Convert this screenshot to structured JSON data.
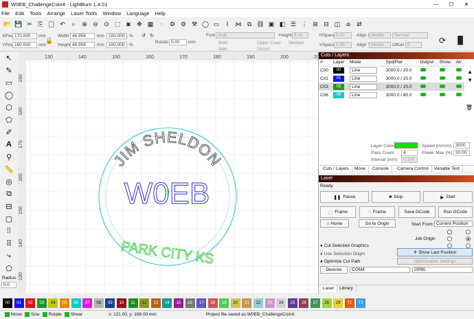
{
  "window": {
    "title": "W0EB_ChallengeCoin4 - LightBurn 1.4.01",
    "controls": [
      "—",
      "☐",
      "✕"
    ]
  },
  "menu": [
    "File",
    "Edit",
    "Tools",
    "Arrange",
    "Laser Tools",
    "Window",
    "Language",
    "Help"
  ],
  "toolbar_icons": [
    "open-icon",
    "save-icon",
    "cut-icon",
    "copy-icon",
    "paste-icon",
    "undo-icon",
    "search-icon",
    "zoom-in-icon",
    "zoom-out-icon",
    "zoom-fit-icon",
    "frame-icon",
    "camera-icon",
    "move-icon",
    "grid-icon",
    "bulb-icon",
    "gear-icon",
    "settings-icon",
    "tools-icon",
    "circle-icon",
    "rect-icon",
    "path-icon",
    "node-icon",
    "bool-icon",
    "chain-icon",
    "group-icon",
    "mirror-icon",
    "align-icon",
    "dist-icon",
    "ungroup-icon",
    "weld-icon",
    "offset-icon",
    "array-icon",
    "flip-icon"
  ],
  "props": {
    "xpos_label": "XPos",
    "xpos": "170.000",
    "ypos_label": "YPos",
    "ypos": "160.000",
    "mm": "mm",
    "width_label": "Width",
    "width": "46.958",
    "height_label": "Height",
    "height": "46.958",
    "pct_w": "100.000",
    "pct_h": "100.000",
    "pct": "%",
    "rotate_label": "Rotate",
    "rotate": "0.00",
    "font_label": "Font",
    "font": "Arial",
    "fheight_label": "Height",
    "fheight": "5.00",
    "bold": "Bold",
    "italic": "Italic",
    "upper": "Upper Case",
    "distort": "Distort",
    "welded": "Welded",
    "hspace_label": "HSpace",
    "hspace": "0.00",
    "vspace_label": "VSpace",
    "vspace": "0.00",
    "alignx_label": "Align X",
    "alignx": "Middle",
    "aligny_label": "Align Y",
    "aligny": "Middle",
    "normal": "Normal",
    "offset_label": "Offset",
    "offset": "0"
  },
  "ruler_top": [
    "130",
    "140",
    "150",
    "160",
    "170",
    "180",
    "190",
    "200",
    "210"
  ],
  "ruler_left": [
    "190",
    "180",
    "170",
    "160",
    "150",
    "140",
    "130"
  ],
  "canvas": {
    "arc_text": "JIM SHELDON",
    "center_text": "W0EB",
    "bottom_text": "PARK CITY KS"
  },
  "cuts_panel": {
    "title": "Cuts / Layers",
    "headers": [
      "#",
      "Layer",
      "Mode",
      "Spd/Pwr",
      "Output",
      "Show",
      "Air"
    ],
    "rows": [
      {
        "id": "C00",
        "layer": "00",
        "color": "#000000",
        "mode": "Line",
        "spdpwr": "3000.0 / 20.0"
      },
      {
        "id": "C01",
        "layer": "01",
        "color": "#1414e6",
        "mode": "Line",
        "spdpwr": "3000.0 / 20.0"
      },
      {
        "id": "C03",
        "layer": "03",
        "color": "#1e9628",
        "mode": "Line",
        "spdpwr": "3000.0 / 20.0"
      },
      {
        "id": "C06",
        "layer": "06",
        "color": "#14c8c8",
        "mode": "Line",
        "spdpwr": "3000.0 / 80.0"
      }
    ],
    "layer_color_label": "Layer Color",
    "speed_label": "Speed (mm/m)",
    "speed": "3000",
    "pass_label": "Pass Count",
    "pass": "4",
    "power_label": "Power Max (%)",
    "power": "20.00",
    "interval_label": "Interval (mm)",
    "interval": "0.100",
    "tabs": [
      "Cuts / Layers",
      "Move",
      "Console",
      "Camera Control",
      "Variable Text"
    ]
  },
  "laser_panel": {
    "title": "Laser",
    "status": "Ready",
    "pause": "Pause",
    "stop": "Stop",
    "start": "Start",
    "frame1": "Frame",
    "frame2": "Frame",
    "save_gcode": "Save GCode",
    "run_gcode": "Run GCode",
    "home": "Home",
    "go_origin": "Go to Origin",
    "start_from_label": "Start From:",
    "start_from": "Current Position",
    "job_origin_label": "Job Origin",
    "cut_selected": "Cut Selected Graphics",
    "use_selection": "Use Selection Origin",
    "optimize": "Optimize Cut Path",
    "show_last": "Show Last Position",
    "opt_settings": "Optimization Settings",
    "devices": "Devices",
    "port": "COM4",
    "firmware": "GRBL",
    "tabs": [
      "Laser",
      "Library"
    ]
  },
  "palette": [
    {
      "l": "00",
      "c": "#000000"
    },
    {
      "l": "01",
      "c": "#1414e6"
    },
    {
      "l": "02",
      "c": "#dc1414"
    },
    {
      "l": "03",
      "c": "#1e9628"
    },
    {
      "l": "04",
      "c": "#c8c800"
    },
    {
      "l": "05",
      "c": "#e68c00"
    },
    {
      "l": "06",
      "c": "#14c8c8"
    },
    {
      "l": "07",
      "c": "#e614e6"
    },
    {
      "l": "08",
      "c": "#b4b4b4"
    },
    {
      "l": "09",
      "c": "#1e3c96"
    },
    {
      "l": "10",
      "c": "#961414"
    },
    {
      "l": "11",
      "c": "#14961e"
    },
    {
      "l": "12",
      "c": "#96961e"
    },
    {
      "l": "13",
      "c": "#b46414"
    },
    {
      "l": "14",
      "c": "#1e9696"
    },
    {
      "l": "15",
      "c": "#961e96"
    },
    {
      "l": "16",
      "c": "#787878"
    },
    {
      "l": "17",
      "c": "#5a5ac8"
    },
    {
      "l": "18",
      "c": "#c85a5a"
    },
    {
      "l": "19",
      "c": "#5ac85a"
    },
    {
      "l": "20",
      "c": "#c8c85a"
    },
    {
      "l": "21",
      "c": "#c8965a"
    },
    {
      "l": "22",
      "c": "#96d2d2"
    },
    {
      "l": "23",
      "c": "#d296d2"
    },
    {
      "l": "24",
      "c": "#d2d2d2"
    },
    {
      "l": "25",
      "c": "#5a3c96"
    },
    {
      "l": "26",
      "c": "#963c5a"
    },
    {
      "l": "27",
      "c": "#3c965a"
    },
    {
      "l": "28",
      "c": "#aad23c"
    },
    {
      "l": "29",
      "c": "#e6d23c"
    },
    {
      "l": "T1",
      "c": "#e65a14"
    },
    {
      "l": "T2",
      "c": "#3ca0e6"
    }
  ],
  "status": {
    "move": "Move",
    "size": "Size",
    "rotate": "Rotate",
    "shear": "Shear",
    "coords": "x: 121.00, y: 198.00 mm",
    "message": "Project file saved as W0EB_ChallengeCoin4."
  }
}
